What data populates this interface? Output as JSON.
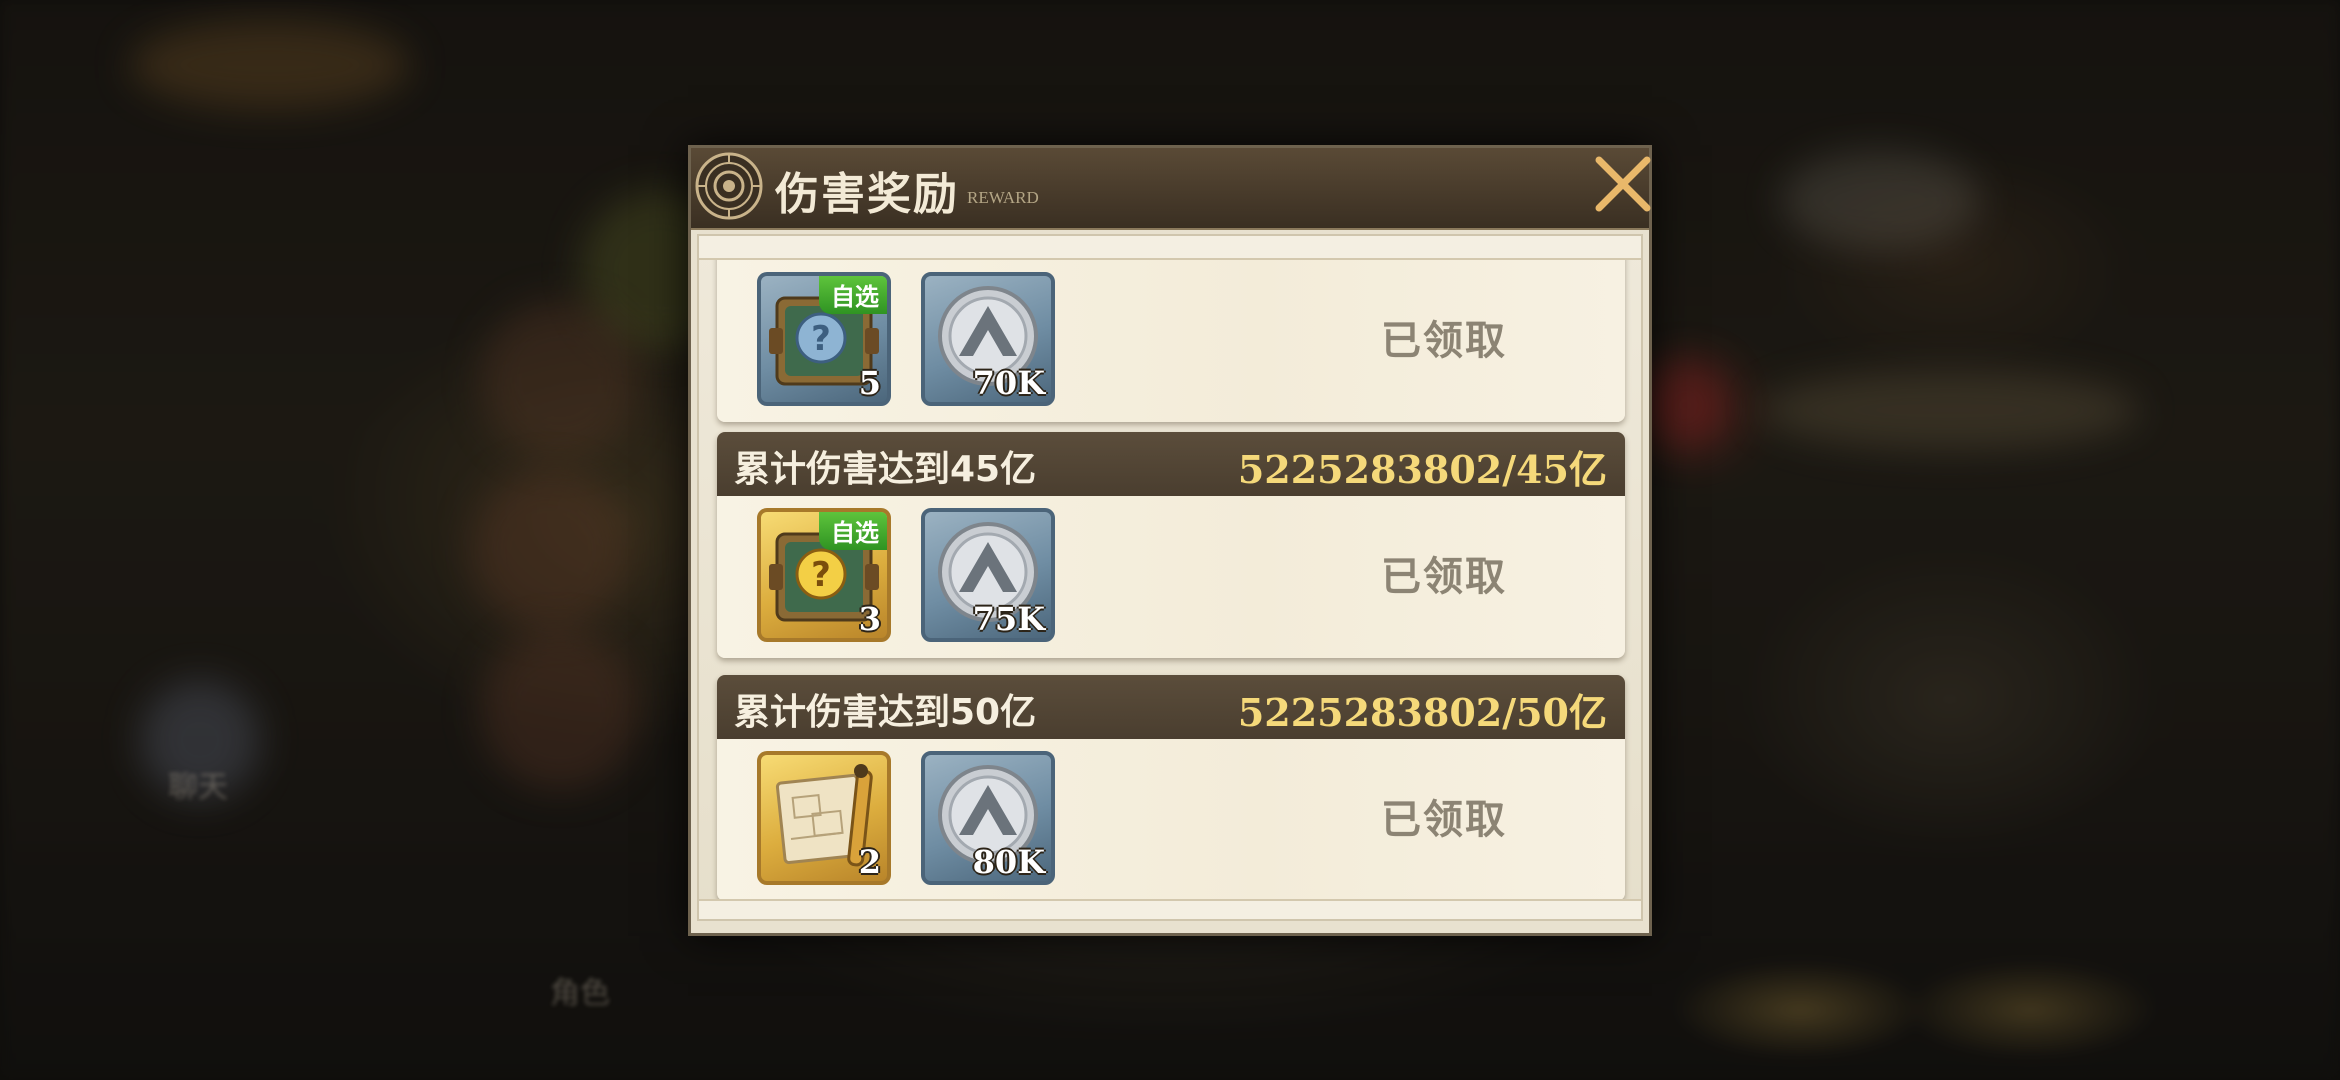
{
  "modal": {
    "title": "伤害奖励",
    "subtitle": "REWARD"
  },
  "background": {
    "chat_label": "聊天",
    "role_label": "角色"
  },
  "rewards": [
    {
      "title": "",
      "progress": "",
      "status": "已领取",
      "items": [
        {
          "icon": "blue-chest-icon",
          "count": "5",
          "badge": "自选"
        },
        {
          "icon": "silver-coin-icon",
          "count": "70K",
          "badge": ""
        }
      ]
    },
    {
      "title": "累计伤害达到45亿",
      "progress": "5225283802/45亿",
      "status": "已领取",
      "items": [
        {
          "icon": "gold-chest-icon",
          "count": "3",
          "badge": "自选"
        },
        {
          "icon": "silver-coin-icon",
          "count": "75K",
          "badge": ""
        }
      ]
    },
    {
      "title": "累计伤害达到50亿",
      "progress": "5225283802/50亿",
      "status": "已领取",
      "items": [
        {
          "icon": "scroll-icon",
          "count": "2",
          "badge": ""
        },
        {
          "icon": "silver-coin-icon",
          "count": "80K",
          "badge": ""
        }
      ]
    }
  ],
  "colors": {
    "progress_text": "#f5d97a",
    "badge_green": "#3fa82c",
    "card_header": "#4f4232"
  }
}
